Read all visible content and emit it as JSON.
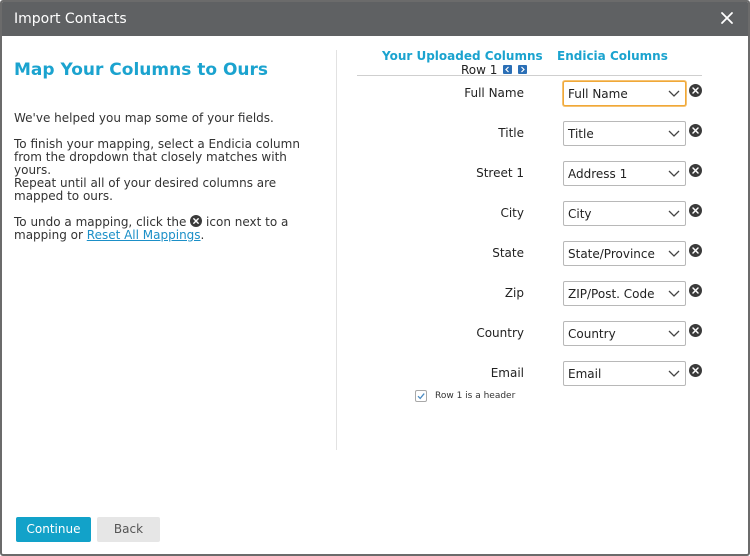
{
  "dialog": {
    "title": "Import Contacts"
  },
  "left": {
    "heading": "Map Your Columns to Ours",
    "para1": "We've helped you map some of your fields.",
    "para2": "To finish your mapping, select a Endicia column from the dropdown that closely matches with yours.",
    "para3": "Repeat until all of your desired columns are mapped to ours.",
    "para4_before": "To undo a mapping, click the",
    "para4_after": "icon next to a mapping or",
    "reset_link": "Reset All Mappings",
    "para4_end": "."
  },
  "mapping": {
    "uploaded_header": "Your Uploaded Columns",
    "endicia_header": "Endicia Columns",
    "row_label": "Row 1",
    "rows": [
      {
        "label": "Full Name",
        "value": "Full Name"
      },
      {
        "label": "Title",
        "value": "Title"
      },
      {
        "label": "Street 1",
        "value": "Address 1"
      },
      {
        "label": "City",
        "value": "City"
      },
      {
        "label": "State",
        "value": "State/Province"
      },
      {
        "label": "Zip",
        "value": "ZIP/Post. Code"
      },
      {
        "label": "Country",
        "value": "Country"
      },
      {
        "label": "Email",
        "value": "Email"
      }
    ],
    "header_checkbox_label": "Row 1 is a header"
  },
  "buttons": {
    "continue": "Continue",
    "back": "Back"
  },
  "colors": {
    "accent": "#1ba3cf",
    "titlebar": "#5f6163",
    "focus": "#f0a838"
  },
  "icons": [
    "close-icon",
    "remove-mapping-icon",
    "chevron-down-icon",
    "arrow-left-icon",
    "arrow-right-icon",
    "checkmark-icon"
  ]
}
